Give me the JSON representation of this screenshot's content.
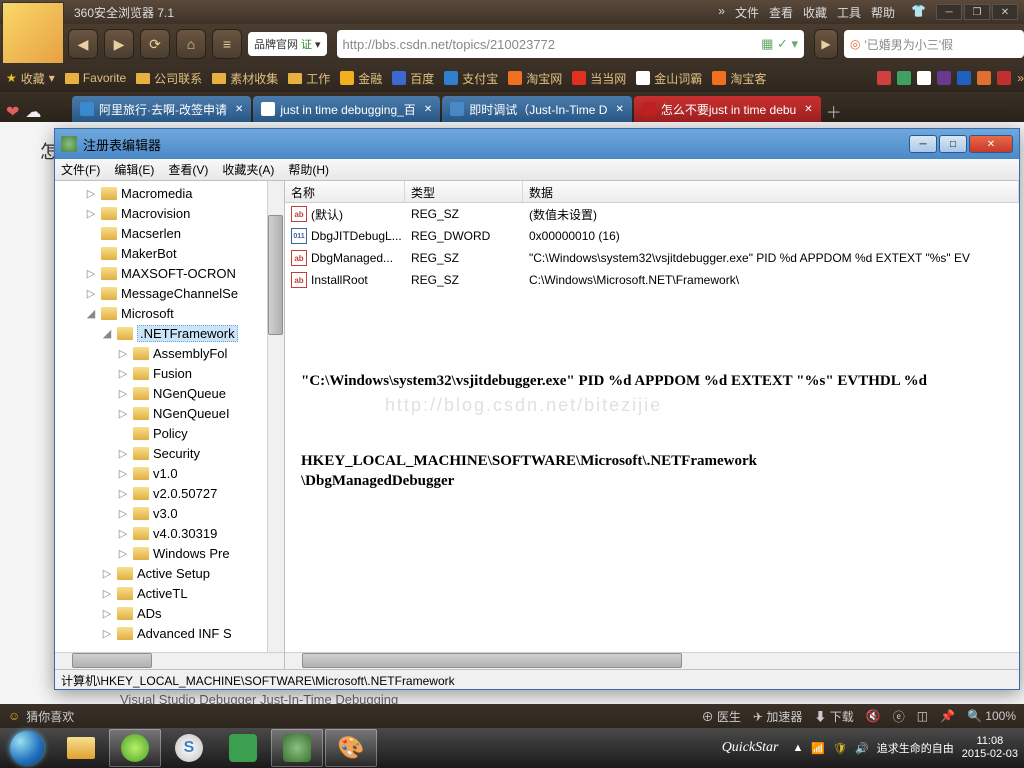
{
  "browser": {
    "title": "360安全浏览器 7.1",
    "menu": {
      "more": "»",
      "file": "文件",
      "view": "查看",
      "fav": "收藏",
      "tools": "工具",
      "help": "帮助"
    },
    "nav": {
      "back": "◀",
      "fwd": "▶",
      "refresh": "⟳",
      "home": "⌂",
      "menu": "≡"
    },
    "brand_badge": {
      "text": "品牌官网",
      "cert": "证"
    },
    "url_placeholder": "http://bbs.csdn.net/topics/210023772",
    "search_placeholder": "'已婚男为小三'假"
  },
  "bookmarks": {
    "fav": "收藏",
    "items": [
      "Favorite",
      "公司联系",
      "素材收集",
      "工作",
      "金融",
      "百度",
      "支付宝",
      "淘宝网",
      "当当网",
      "金山词霸",
      "淘宝客"
    ]
  },
  "tabs": [
    {
      "label": "阿里旅行·去啊-改签申请",
      "active": false
    },
    {
      "label": "just in time debugging_百",
      "active": false
    },
    {
      "label": "即时调试（Just-In-Time D",
      "active": false
    },
    {
      "label": "怎么不要just in time debu",
      "active": true
    }
  ],
  "page": {
    "title_char": "怎",
    "sub_line": "Visual Studio Debugger Just-In-Time Debugging"
  },
  "regedit": {
    "title": "注册表编辑器",
    "menu": {
      "file": "文件(F)",
      "edit": "编辑(E)",
      "view": "查看(V)",
      "fav": "收藏夹(A)",
      "help": "帮助(H)"
    },
    "tree": [
      {
        "indent": 30,
        "exp": "▷",
        "label": "Macromedia"
      },
      {
        "indent": 30,
        "exp": "▷",
        "label": "Macrovision"
      },
      {
        "indent": 30,
        "exp": "",
        "label": "Macserlen"
      },
      {
        "indent": 30,
        "exp": "",
        "label": "MakerBot"
      },
      {
        "indent": 30,
        "exp": "▷",
        "label": "MAXSOFT-OCRON"
      },
      {
        "indent": 30,
        "exp": "▷",
        "label": "MessageChannelSe"
      },
      {
        "indent": 30,
        "exp": "◢",
        "label": "Microsoft"
      },
      {
        "indent": 46,
        "exp": "◢",
        "label": ".NETFramework",
        "sel": true
      },
      {
        "indent": 62,
        "exp": "▷",
        "label": "AssemblyFol"
      },
      {
        "indent": 62,
        "exp": "▷",
        "label": "Fusion"
      },
      {
        "indent": 62,
        "exp": "▷",
        "label": "NGenQueue"
      },
      {
        "indent": 62,
        "exp": "▷",
        "label": "NGenQueueI"
      },
      {
        "indent": 62,
        "exp": "",
        "label": "Policy"
      },
      {
        "indent": 62,
        "exp": "▷",
        "label": "Security"
      },
      {
        "indent": 62,
        "exp": "▷",
        "label": "v1.0"
      },
      {
        "indent": 62,
        "exp": "▷",
        "label": "v2.0.50727"
      },
      {
        "indent": 62,
        "exp": "▷",
        "label": "v3.0"
      },
      {
        "indent": 62,
        "exp": "▷",
        "label": "v4.0.30319"
      },
      {
        "indent": 62,
        "exp": "▷",
        "label": "Windows Pre"
      },
      {
        "indent": 46,
        "exp": "▷",
        "label": "Active Setup"
      },
      {
        "indent": 46,
        "exp": "▷",
        "label": "ActiveTL"
      },
      {
        "indent": 46,
        "exp": "▷",
        "label": "ADs"
      },
      {
        "indent": 46,
        "exp": "▷",
        "label": "Advanced INF S"
      }
    ],
    "columns": {
      "name": "名称",
      "type": "类型",
      "data": "数据"
    },
    "values": [
      {
        "icon": "ab",
        "name": "(默认)",
        "type": "REG_SZ",
        "data": "(数值未设置)"
      },
      {
        "icon": "bin",
        "name": "DbgJITDebugL...",
        "type": "REG_DWORD",
        "data": "0x00000010 (16)"
      },
      {
        "icon": "ab",
        "name": "DbgManaged...",
        "type": "REG_SZ",
        "data": "\"C:\\Windows\\system32\\vsjitdebugger.exe\" PID %d APPDOM %d EXTEXT \"%s\" EV"
      },
      {
        "icon": "ab",
        "name": "InstallRoot",
        "type": "REG_SZ",
        "data": "C:\\Windows\\Microsoft.NET\\Framework\\"
      }
    ],
    "overlay1": "\"C:\\Windows\\system32\\vsjitdebugger.exe\" PID %d APPDOM %d EXTEXT \"%s\" EVTHDL %d",
    "watermark": "http://blog.csdn.net/bitezijie",
    "overlay2a": "HKEY_LOCAL_MACHINE\\SOFTWARE\\Microsoft\\.NETFramework",
    "overlay2b": "\\DbgManagedDebugger",
    "status": "计算机\\HKEY_LOCAL_MACHINE\\SOFTWARE\\Microsoft\\.NETFramework"
  },
  "status_bar": {
    "left": "猜你喜欢",
    "doctor": "医生",
    "accel": "加速器",
    "download": "下载",
    "zoom": "100%"
  },
  "taskbar": {
    "quickstar": "QuickStar",
    "tray_text": "追求生命的自由",
    "time": "11:08",
    "date": "2015-02-03"
  }
}
